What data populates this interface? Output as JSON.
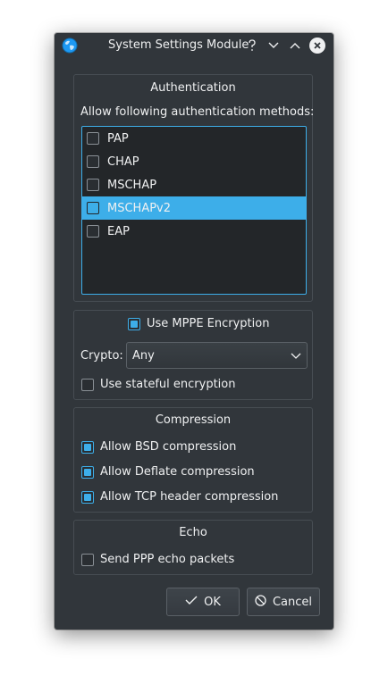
{
  "window": {
    "title": "System Settings Module",
    "icons": [
      "globe-icon",
      "help-icon",
      "minimize-icon",
      "maximize-icon",
      "close-icon"
    ]
  },
  "authentication": {
    "title": "Authentication",
    "prompt": "Allow following authentication methods:",
    "methods": [
      {
        "label": "PAP",
        "checked": false,
        "selected": false
      },
      {
        "label": "CHAP",
        "checked": false,
        "selected": false
      },
      {
        "label": "MSCHAP",
        "checked": false,
        "selected": false
      },
      {
        "label": "MSCHAPv2",
        "checked": false,
        "selected": true
      },
      {
        "label": "EAP",
        "checked": false,
        "selected": false
      }
    ]
  },
  "mppe": {
    "use_mppe_label": "Use MPPE Encryption",
    "use_mppe_checked": true,
    "crypto_label": "Crypto:",
    "crypto_value": "Any",
    "stateful_label": "Use stateful encryption",
    "stateful_checked": false
  },
  "compression": {
    "title": "Compression",
    "bsd_label": "Allow BSD compression",
    "deflate_label": "Allow Deflate compression",
    "tcp_label": "Allow TCP header compression",
    "bsd_checked": true,
    "deflate_checked": true,
    "tcp_checked": true
  },
  "echo": {
    "title": "Echo",
    "send_label": "Send PPP echo packets",
    "send_checked": false
  },
  "buttons": {
    "ok_label": "OK",
    "cancel_label": "Cancel"
  },
  "colors": {
    "window_bg": "#31363b",
    "accent": "#3daee9",
    "text": "#eff0f1"
  }
}
